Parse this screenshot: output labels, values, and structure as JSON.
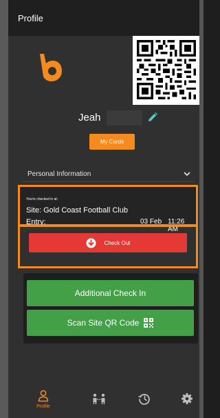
{
  "header": {
    "title": "Profile"
  },
  "profile": {
    "name": "Jeah",
    "my_cards_label": "My Cards"
  },
  "personal_info": {
    "label": "Personal Information"
  },
  "checkin": {
    "heading": "You're checked in at:",
    "site": "Site: Gold Coast Football Club",
    "entry_label": "Entry:",
    "entry_date": "03 Feb",
    "entry_time": "11:26 AM",
    "checkout_label": "Check Out"
  },
  "actions": {
    "additional_label": "Additional Check In",
    "scan_label": "Scan Site QR Code"
  },
  "nav": {
    "items": [
      {
        "label": "Profile",
        "icon": "person-icon",
        "active": true
      },
      {
        "label": "",
        "icon": "check-ins-icon",
        "active": false
      },
      {
        "label": "",
        "icon": "history-icon",
        "active": false
      },
      {
        "label": "",
        "icon": "gear-icon",
        "active": false
      }
    ]
  },
  "colors": {
    "accent": "#f58a1f",
    "checkout": "#e53935",
    "action": "#43a047",
    "pencil": "#4dd0c0",
    "background": "#303030"
  }
}
